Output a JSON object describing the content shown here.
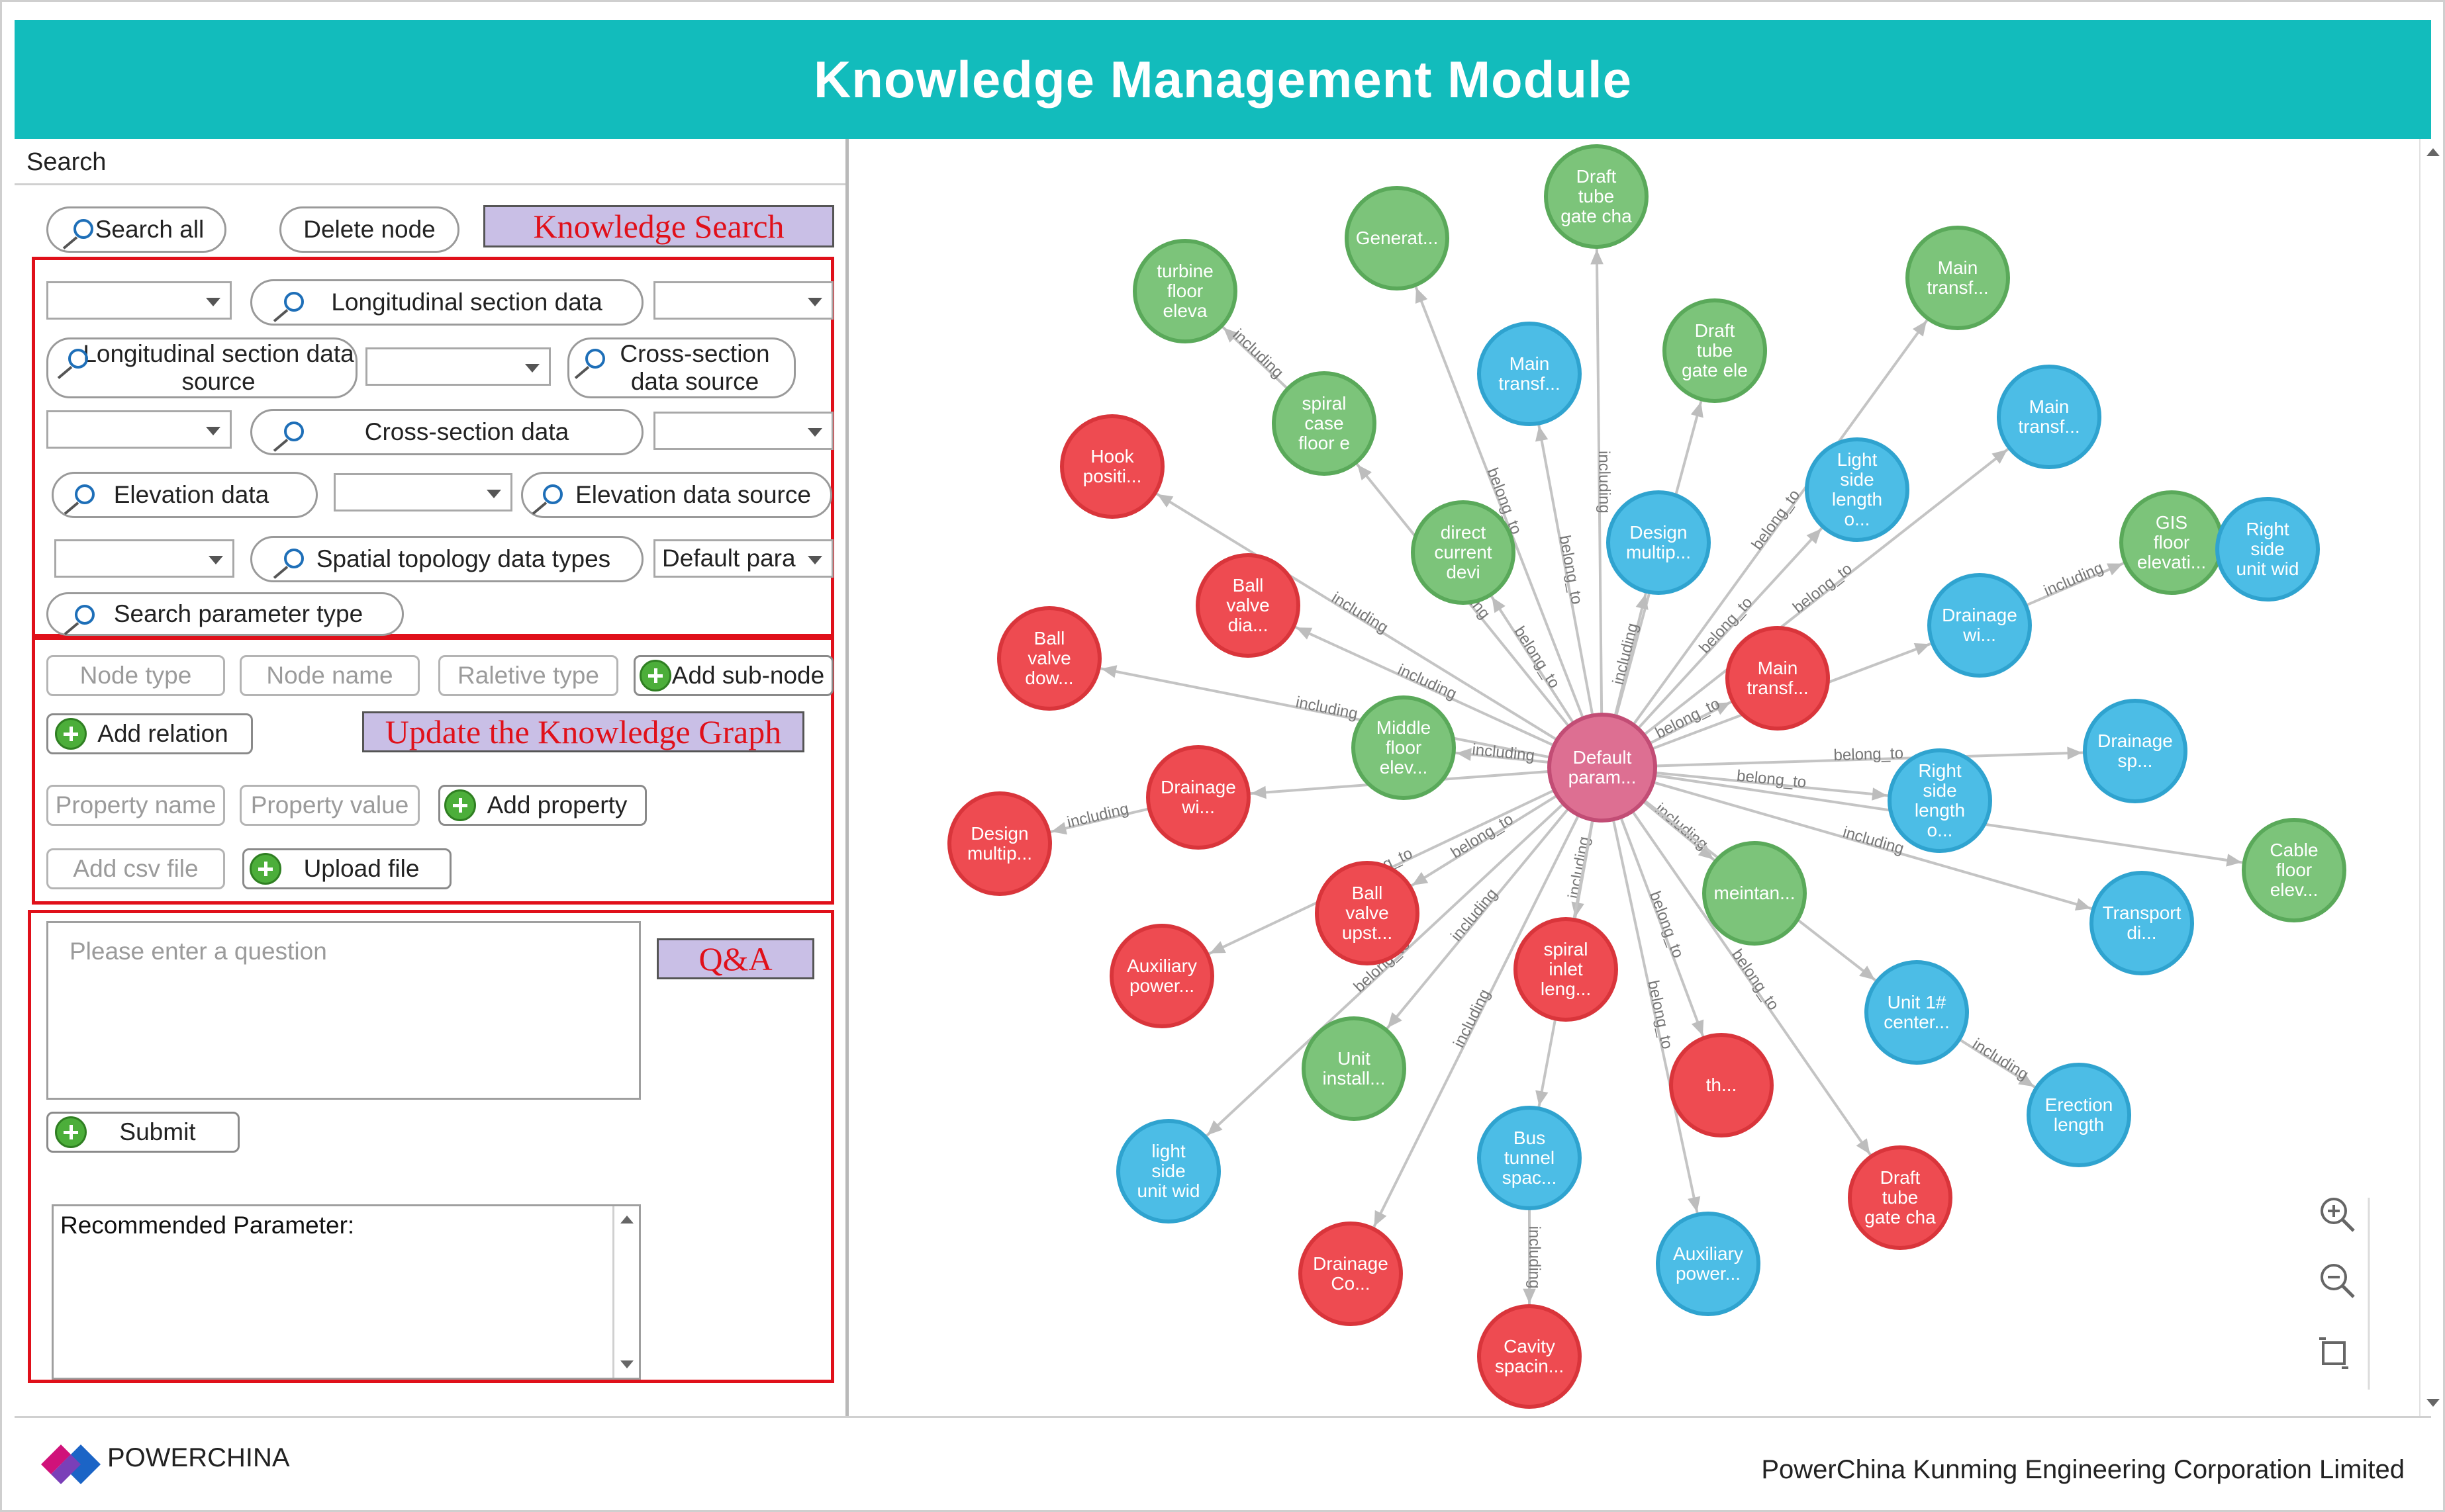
{
  "app": {
    "title": "Knowledge Management Module"
  },
  "search_panel": {
    "label": "Search",
    "search_all": "Search all",
    "delete_node": "Delete node",
    "knowledge_search_tag": "Knowledge Search",
    "longitudinal_section_data": "Longitudinal section data",
    "longitudinal_section_data_source": "Longitudinal section data source",
    "cross_section_data_source": "Cross-section data source",
    "cross_section_data": "Cross-section data",
    "elevation_data": "Elevation data",
    "elevation_data_source": "Elevation data source",
    "spatial_topology_data_types": "Spatial topology data types",
    "default_param_select": "Default para",
    "search_parameter_type": "Search parameter type"
  },
  "update_panel": {
    "node_type_placeholder": "Node type",
    "node_name_placeholder": "Node name",
    "relation_type_placeholder": "Raletive type",
    "add_subnode": "Add sub-node",
    "add_relation": "Add relation",
    "update_tag": "Update the Knowledge Graph",
    "property_name_placeholder": "Property name",
    "property_value_placeholder": "Property value",
    "add_property": "Add property",
    "add_csv_placeholder": "Add csv file",
    "upload_file": "Upload file"
  },
  "qa_panel": {
    "question_placeholder": "Please enter a question",
    "qa_tag": "Q&A",
    "submit": "Submit",
    "recommended_label": "Recommended Parameter:"
  },
  "footer": {
    "brand": "POWERCHINA",
    "company": "PowerChina Kunming Engineering Corporation Limited"
  },
  "colors": {
    "title_bar": "#12bcbc",
    "green": "#7cc47a",
    "blue": "#4cbde6",
    "red": "#ee4b51",
    "center": "#dd6f92",
    "tag_red": "#e0101a"
  },
  "graph": {
    "center": {
      "label": "Default param..."
    },
    "nodes": [
      {
        "label": "turbine floor eleva",
        "color": "green"
      },
      {
        "label": "Generat...",
        "color": "green"
      },
      {
        "label": "Draft tube gate cha",
        "color": "green"
      },
      {
        "label": "Main transf...",
        "color": "green"
      },
      {
        "label": "spiral case floor e",
        "color": "green"
      },
      {
        "label": "Main transf...",
        "color": "blue"
      },
      {
        "label": "Draft tube gate ele",
        "color": "green"
      },
      {
        "label": "Main transf...",
        "color": "blue"
      },
      {
        "label": "Hook positi...",
        "color": "red"
      },
      {
        "label": "direct current devi",
        "color": "green"
      },
      {
        "label": "Design multip...",
        "color": "blue"
      },
      {
        "label": "Light side length o...",
        "color": "blue"
      },
      {
        "label": "GIS floor elevati...",
        "color": "green"
      },
      {
        "label": "Right side unit wid",
        "color": "blue"
      },
      {
        "label": "Ball valve dia...",
        "color": "red"
      },
      {
        "label": "Drainage wi...",
        "color": "blue"
      },
      {
        "label": "Ball valve dow...",
        "color": "red"
      },
      {
        "label": "Main transf...",
        "color": "red"
      },
      {
        "label": "Middle floor elev...",
        "color": "green"
      },
      {
        "label": "Drainage sp...",
        "color": "blue"
      },
      {
        "label": "Drainage wi...",
        "color": "red"
      },
      {
        "label": "Right side length o...",
        "color": "blue"
      },
      {
        "label": "Design multip...",
        "color": "red"
      },
      {
        "label": "Cable floor elev...",
        "color": "green"
      },
      {
        "label": "meintan...",
        "color": "green"
      },
      {
        "label": "Ball valve upst...",
        "color": "red"
      },
      {
        "label": "Transport di...",
        "color": "blue"
      },
      {
        "label": "Auxiliary power...",
        "color": "red"
      },
      {
        "label": "spiral inlet leng...",
        "color": "red"
      },
      {
        "label": "Unit 1# center...",
        "color": "blue"
      },
      {
        "label": "Unit install...",
        "color": "green"
      },
      {
        "label": "th...",
        "color": "red"
      },
      {
        "label": "Erection length",
        "color": "blue"
      },
      {
        "label": "light side unit wid",
        "color": "blue"
      },
      {
        "label": "Bus tunnel spac...",
        "color": "blue"
      },
      {
        "label": "Draft tube gate cha",
        "color": "red"
      },
      {
        "label": "Drainage Co...",
        "color": "red"
      },
      {
        "label": "Auxiliary power...",
        "color": "blue"
      },
      {
        "label": "Cavity spacin...",
        "color": "red"
      }
    ],
    "edge_labels": [
      "including",
      "belong_to"
    ],
    "zoom_controls": [
      "zoom-in-icon",
      "zoom-out-icon",
      "fit-screen-icon"
    ]
  }
}
